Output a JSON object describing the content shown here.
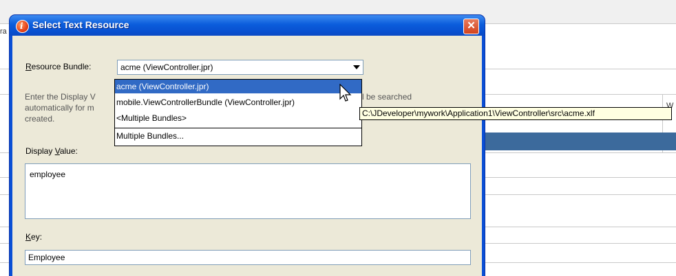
{
  "background": {
    "left_fragment": "ra",
    "right_fragment": "W"
  },
  "dialog": {
    "title": "Select Text Resource",
    "close_symbol": "✕",
    "resource_bundle": {
      "label_first": "R",
      "label_rest": "esource Bundle:",
      "value": "acme (ViewController.jpr)"
    },
    "description": {
      "line1_start": "Enter the Display V",
      "line1_end": "will be searched",
      "line2_start": "automatically for m",
      "line3": "created."
    },
    "display_value": {
      "label_start": "Display ",
      "label_u": "V",
      "label_end": "alue:",
      "value": "employee"
    },
    "key": {
      "label_u": "K",
      "label_end": "ey:",
      "value": "Employee"
    }
  },
  "dropdown": {
    "items": [
      {
        "label": "acme (ViewController.jpr)",
        "selected": true
      },
      {
        "label": "mobile.ViewControllerBundle (ViewController.jpr)",
        "selected": false
      },
      {
        "label": "<Multiple Bundles>",
        "selected": false
      },
      {
        "label": "Multiple Bundles...",
        "selected": false
      }
    ]
  },
  "tooltip": {
    "text": "C:\\JDeveloper\\mywork\\Application1\\ViewController\\src\\acme.xlf"
  },
  "colors": {
    "titlebar": "#0b5ddc",
    "selection": "#316ac5",
    "dialog_bg": "#ece9d8",
    "tooltip_bg": "#ffffe1"
  }
}
